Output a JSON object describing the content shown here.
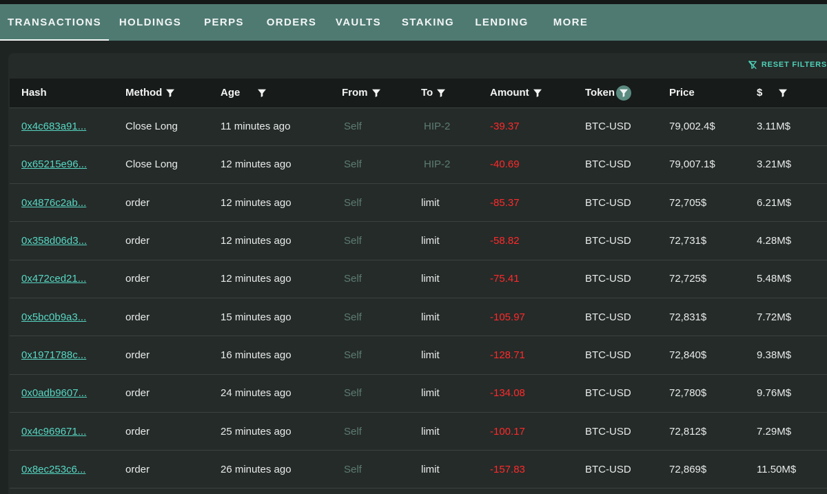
{
  "tabs": [
    {
      "label": "TRANSACTIONS",
      "active": true
    },
    {
      "label": "HOLDINGS",
      "active": false
    },
    {
      "label": "PERPS",
      "active": false
    },
    {
      "label": "ORDERS",
      "active": false
    },
    {
      "label": "VAULTS",
      "active": false
    },
    {
      "label": "STAKING",
      "active": false
    },
    {
      "label": "LENDING",
      "active": false
    },
    {
      "label": "MORE",
      "active": false
    }
  ],
  "reset_filters": "RESET FILTERS",
  "columns": [
    "Hash",
    "Method",
    "Age",
    "From",
    "To",
    "Amount",
    "Token",
    "Price",
    "$"
  ],
  "rows": [
    {
      "hash": "0x4c683a91...",
      "method": "Close Long",
      "age": "11 minutes ago",
      "from": "Self",
      "to": "HIP-2",
      "amount": "-39.37",
      "token": "BTC-USD",
      "price": "79,002.4$",
      "usd": "3.11M$"
    },
    {
      "hash": "0x65215e96...",
      "method": "Close Long",
      "age": "12 minutes ago",
      "from": "Self",
      "to": "HIP-2",
      "amount": "-40.69",
      "token": "BTC-USD",
      "price": "79,007.1$",
      "usd": "3.21M$"
    },
    {
      "hash": "0x4876c2ab...",
      "method": "order",
      "age": "12 minutes ago",
      "from": "Self",
      "to": "limit",
      "amount": "-85.37",
      "token": "BTC-USD",
      "price": "72,705$",
      "usd": "6.21M$"
    },
    {
      "hash": "0x358d06d3...",
      "method": "order",
      "age": "12 minutes ago",
      "from": "Self",
      "to": "limit",
      "amount": "-58.82",
      "token": "BTC-USD",
      "price": "72,731$",
      "usd": "4.28M$"
    },
    {
      "hash": "0x472ced21...",
      "method": "order",
      "age": "12 minutes ago",
      "from": "Self",
      "to": "limit",
      "amount": "-75.41",
      "token": "BTC-USD",
      "price": "72,725$",
      "usd": "5.48M$"
    },
    {
      "hash": "0x5bc0b9a3...",
      "method": "order",
      "age": "15 minutes ago",
      "from": "Self",
      "to": "limit",
      "amount": "-105.97",
      "token": "BTC-USD",
      "price": "72,831$",
      "usd": "7.72M$"
    },
    {
      "hash": "0x1971788c...",
      "method": "order",
      "age": "16 minutes ago",
      "from": "Self",
      "to": "limit",
      "amount": "-128.71",
      "token": "BTC-USD",
      "price": "72,840$",
      "usd": "9.38M$"
    },
    {
      "hash": "0x0adb9607...",
      "method": "order",
      "age": "24 minutes ago",
      "from": "Self",
      "to": "limit",
      "amount": "-134.08",
      "token": "BTC-USD",
      "price": "72,780$",
      "usd": "9.76M$"
    },
    {
      "hash": "0x4c969671...",
      "method": "order",
      "age": "25 minutes ago",
      "from": "Self",
      "to": "limit",
      "amount": "-100.17",
      "token": "BTC-USD",
      "price": "72,812$",
      "usd": "7.29M$"
    },
    {
      "hash": "0x8ec253c6...",
      "method": "order",
      "age": "26 minutes ago",
      "from": "Self",
      "to": "limit",
      "amount": "-157.83",
      "token": "BTC-USD",
      "price": "72,869$",
      "usd": "11.50M$"
    }
  ],
  "colors": {
    "tabbar": "#4f7a72",
    "hash_link": "#56d7c3",
    "negative": "#ff2a2a",
    "muted": "#5d7c73",
    "active_filter": "#5a8a80"
  },
  "icons": {
    "filter": "filter-icon",
    "reset": "filter-off-icon"
  }
}
